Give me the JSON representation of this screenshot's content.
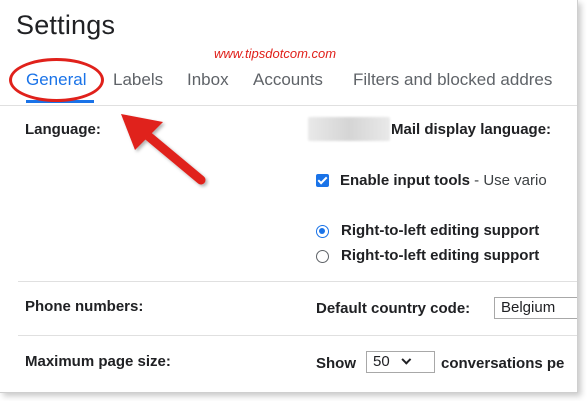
{
  "title": "Settings",
  "watermark": "www.tipsdotcom.com",
  "tabs": [
    {
      "label": "General"
    },
    {
      "label": "Labels"
    },
    {
      "label": "Inbox"
    },
    {
      "label": "Accounts"
    },
    {
      "label": "Filters and blocked addres"
    }
  ],
  "language": {
    "label": "Language:",
    "mail_display_label": "Mail display language:",
    "input_tools_label": "Enable input tools",
    "input_tools_desc": " - Use vario",
    "rtl_on_label": "Right-to-left editing support",
    "rtl_off_label": "Right-to-left editing support"
  },
  "phone": {
    "label": "Phone numbers:",
    "country_label": "Default country code:",
    "country_value": "Belgium"
  },
  "page_size": {
    "label": "Maximum page size:",
    "show_label": "Show",
    "value": "50",
    "suffix": "conversations pe"
  },
  "colors": {
    "accent": "#1a73e8",
    "annotation": "#e0211b"
  }
}
